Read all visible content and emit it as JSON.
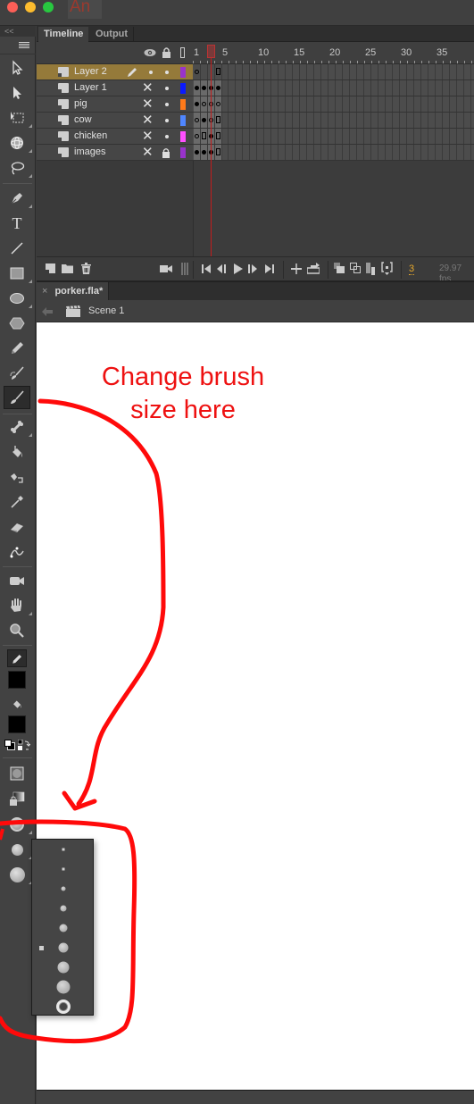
{
  "app": {
    "logo_text": "An",
    "window_controls": [
      "close",
      "minimize",
      "zoom"
    ]
  },
  "toolbar": {
    "collapse_label": "<<",
    "tools": [
      {
        "name": "selection-tool",
        "icon": "arrow-outline-icon"
      },
      {
        "name": "subselection-tool",
        "icon": "arrow-solid-icon"
      },
      {
        "name": "free-transform-tool",
        "icon": "free-transform-icon"
      },
      {
        "name": "3d-rotation-tool",
        "icon": "3d-rotation-icon"
      },
      {
        "name": "lasso-tool",
        "icon": "lasso-icon"
      },
      {
        "name": "pen-tool",
        "icon": "pen-icon"
      },
      {
        "name": "text-tool",
        "icon": "text-icon",
        "glyph": "T"
      },
      {
        "name": "line-tool",
        "icon": "line-icon"
      },
      {
        "name": "rectangle-tool",
        "icon": "rectangle-icon"
      },
      {
        "name": "oval-tool",
        "icon": "oval-icon"
      },
      {
        "name": "polystar-tool",
        "icon": "polystar-icon"
      },
      {
        "name": "pencil-tool",
        "icon": "pencil-icon"
      },
      {
        "name": "paint-brush-tool",
        "icon": "paint-brush-icon"
      },
      {
        "name": "brush-tool",
        "icon": "brush-icon",
        "selected": true
      },
      {
        "name": "bone-tool",
        "icon": "bone-icon"
      },
      {
        "name": "paint-bucket-tool",
        "icon": "paint-bucket-icon"
      },
      {
        "name": "ink-bottle-tool",
        "icon": "ink-bottle-icon"
      },
      {
        "name": "eyedropper-tool",
        "icon": "eyedropper-icon"
      },
      {
        "name": "eraser-tool",
        "icon": "eraser-icon"
      },
      {
        "name": "width-tool",
        "icon": "width-icon"
      },
      {
        "name": "camera-tool",
        "icon": "camera-icon"
      },
      {
        "name": "hand-tool",
        "icon": "hand-icon"
      },
      {
        "name": "zoom-tool",
        "icon": "magnifier-icon"
      }
    ],
    "stroke_color": "#000000",
    "fill_color": "#000000",
    "brush_mode_buttons": [
      "use-pressure",
      "lock-fill",
      "brush-mode",
      "brush-size",
      "brush-shape"
    ]
  },
  "timeline": {
    "tabs": [
      {
        "label": "Timeline",
        "active": true
      },
      {
        "label": "Output",
        "active": false
      }
    ],
    "frame_numbers": [
      "1",
      "5",
      "10",
      "15",
      "20",
      "25",
      "30",
      "35"
    ],
    "current_frame": "3",
    "fps": "29.97 fps",
    "layers": [
      {
        "name": "Layer 2",
        "active": true,
        "visible_state": "pencil",
        "lock_state": "dot",
        "color": "#9933cc",
        "frames": [
          "empty",
          "",
          "",
          "end"
        ]
      },
      {
        "name": "Layer 1",
        "active": false,
        "visible_state": "hidden",
        "lock_state": "dot",
        "color": "#0a1aff",
        "frames": [
          "key",
          "key",
          "key",
          "key"
        ]
      },
      {
        "name": "pig",
        "active": false,
        "visible_state": "hidden",
        "lock_state": "dot",
        "color": "#ff7a1a",
        "frames": [
          "key",
          "empty",
          "empty",
          "empty"
        ]
      },
      {
        "name": "cow",
        "active": false,
        "visible_state": "hidden",
        "lock_state": "dot",
        "color": "#4f86ff",
        "frames": [
          "empty",
          "key",
          "empty",
          "end"
        ]
      },
      {
        "name": "chicken",
        "active": false,
        "visible_state": "hidden",
        "lock_state": "dot",
        "color": "#ff4fff",
        "frames": [
          "empty",
          "end",
          "key",
          "end"
        ]
      },
      {
        "name": "images",
        "active": false,
        "visible_state": "hidden",
        "lock_state": "locked",
        "color": "#9933cc",
        "frames": [
          "key",
          "key",
          "key",
          "end"
        ]
      }
    ]
  },
  "document": {
    "tab_label": "porker.fla*",
    "scene_label": "Scene 1"
  },
  "brush_size_popup": {
    "sizes": [
      1,
      2,
      3,
      4,
      5,
      6,
      7,
      8,
      9
    ],
    "selected_index": 5
  },
  "annotation": {
    "text_line1": "Change brush",
    "text_line2": "size here",
    "color": "#ee1111"
  }
}
